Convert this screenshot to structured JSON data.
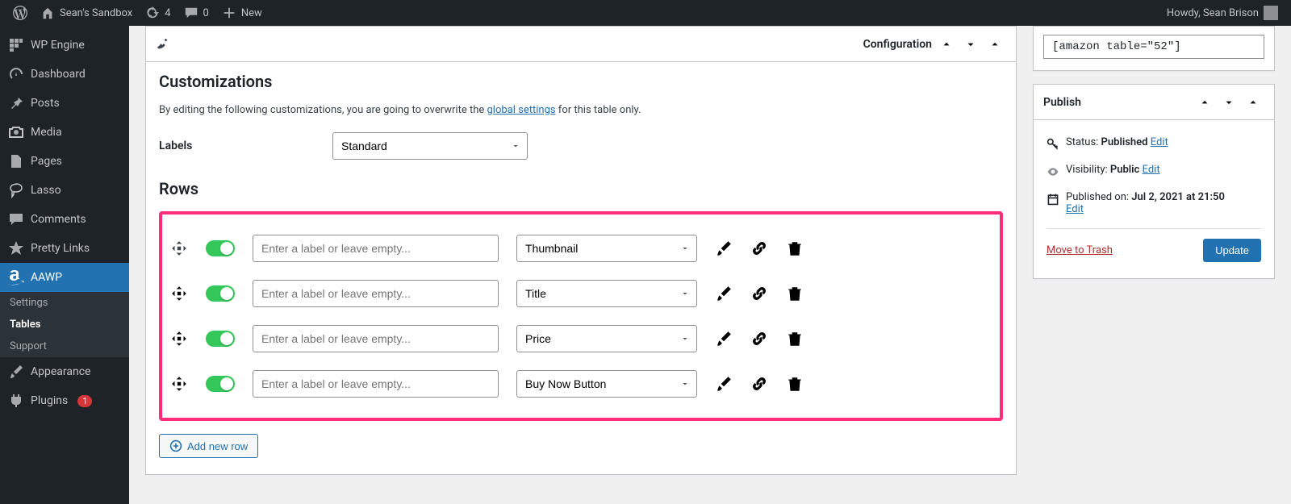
{
  "adminbar": {
    "site_name": "Sean's Sandbox",
    "updates": "4",
    "comments": "0",
    "new": "New",
    "howdy": "Howdy, Sean Brison"
  },
  "sidebar": {
    "items": [
      {
        "label": "WP Engine",
        "icon": "wpengine"
      },
      {
        "label": "Dashboard",
        "icon": "dashboard"
      },
      {
        "label": "Posts",
        "icon": "pin"
      },
      {
        "label": "Media",
        "icon": "media"
      },
      {
        "label": "Pages",
        "icon": "pages"
      },
      {
        "label": "Lasso",
        "icon": "lasso"
      },
      {
        "label": "Comments",
        "icon": "comment"
      },
      {
        "label": "Pretty Links",
        "icon": "star"
      },
      {
        "label": "AAWP",
        "icon": "amazon",
        "current": true
      },
      {
        "label": "Appearance",
        "icon": "brush"
      },
      {
        "label": "Plugins",
        "icon": "plugin",
        "badge": "1"
      }
    ],
    "submenu": [
      {
        "label": "Settings"
      },
      {
        "label": "Tables",
        "active": true
      },
      {
        "label": "Support"
      }
    ]
  },
  "config": {
    "panel_title": "Configuration",
    "section_title": "Customizations",
    "desc_prefix": "By editing the following customizations, you are going to overwrite the ",
    "desc_link": "global settings",
    "desc_suffix": " for this table only.",
    "labels_label": "Labels",
    "labels_value": "Standard",
    "rows_title": "Rows",
    "row_placeholder": "Enter a label or leave empty...",
    "rows": [
      {
        "type": "Thumbnail"
      },
      {
        "type": "Title"
      },
      {
        "type": "Price"
      },
      {
        "type": "Buy Now Button"
      }
    ],
    "add_row": "Add new row"
  },
  "shortcode": "[amazon table=\"52\"]",
  "publish": {
    "title": "Publish",
    "status_label": "Status: ",
    "status_value": "Published",
    "visibility_label": "Visibility: ",
    "visibility_value": "Public",
    "published_label": "Published on: ",
    "published_value": "Jul 2, 2021 at 21:50",
    "edit": "Edit",
    "trash": "Move to Trash",
    "update": "Update"
  }
}
